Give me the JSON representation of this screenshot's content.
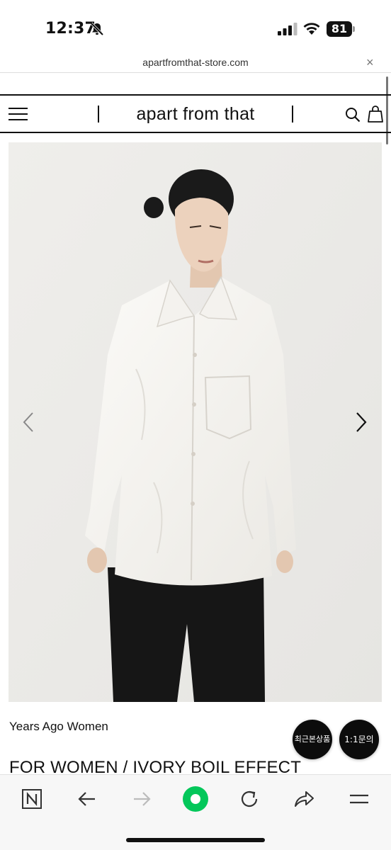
{
  "status_bar": {
    "time": "12:37",
    "battery": "81",
    "icons": [
      "bell-slash-icon",
      "cellular-signal-icon",
      "wifi-icon",
      "battery-icon"
    ]
  },
  "browser": {
    "url": "apartfromthat-store.com",
    "close_symbol": "×"
  },
  "header": {
    "brand": "apart from that",
    "icons": [
      "menu-icon",
      "search-icon",
      "shopping-bag-icon"
    ]
  },
  "product": {
    "image_icons": [
      "chevron-left-icon",
      "chevron-right-icon"
    ],
    "brand_line": "Years Ago Women",
    "title": "FOR WOMEN / IVORY BOIL EFFECT"
  },
  "floating_buttons": {
    "recent": "최근본상품",
    "inquiry": "1:1문의"
  },
  "toolbar": {
    "icons": [
      "naver-n-icon",
      "back-arrow-icon",
      "forward-arrow-icon",
      "green-home-icon",
      "refresh-icon",
      "share-icon",
      "menu-lines-icon"
    ],
    "accent": "#03c75a"
  }
}
